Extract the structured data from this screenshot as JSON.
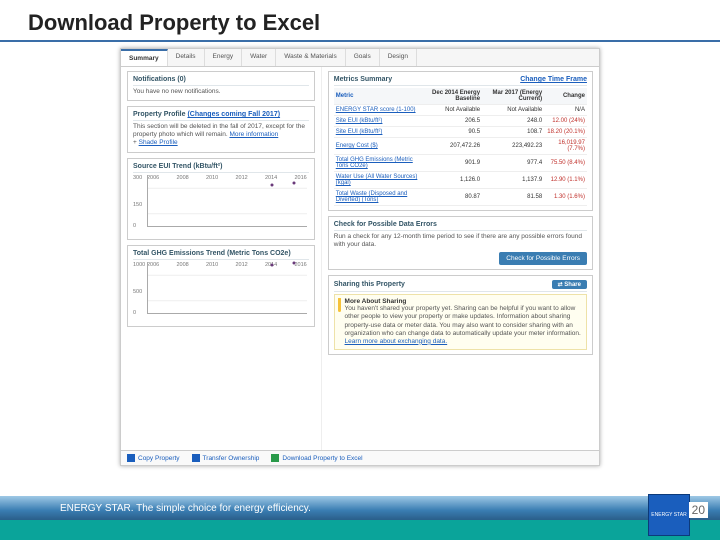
{
  "slide": {
    "title": "Download Property to Excel",
    "page_number": "20"
  },
  "footer": {
    "tagline": "ENERGY STAR. The simple choice for energy efficiency.",
    "logo": "ENERGY STAR"
  },
  "tabs": [
    "Summary",
    "Details",
    "Energy",
    "Water",
    "Waste & Materials",
    "Goals",
    "Design"
  ],
  "notifications": {
    "title": "Notifications (0)",
    "body": "You have no new notifications."
  },
  "profile": {
    "title": "Property Profile",
    "changes_link": "(Changes coming Fall 2017)",
    "body": "This section will be deleted in the fall of 2017, except for the property photo which will remain.",
    "more": "More information",
    "shade": "Shade Profile"
  },
  "source_chart": {
    "title": "Source EUI Trend (kBtu/ft²)"
  },
  "ghg_chart": {
    "title": "Total GHG Emissions Trend (Metric Tons CO2e)"
  },
  "metrics_summary": {
    "title": "Metrics Summary",
    "change_link": "Change Time Frame"
  },
  "metrics_headers": {
    "metric": "Metric",
    "baseline": "Dec 2014 Energy Baseline",
    "current": "Mar 2017 (Energy Current)",
    "change": "Change"
  },
  "metrics_rows": [
    {
      "label": "ENERGY STAR score (1-100)",
      "b": "Not Available",
      "c": "Not Available",
      "d": "N/A",
      "cls": ""
    },
    {
      "label": "Site EUI (kBtu/ft²)",
      "b": "206.5",
      "c": "248.0",
      "d": "12.00 (24%)",
      "cls": "chg-dn"
    },
    {
      "label": "Site EUI (kBtu/ft²)",
      "b": "90.5",
      "c": "108.7",
      "d": "18.20 (20.1%)",
      "cls": "chg-dn"
    },
    {
      "label": "Energy Cost ($)",
      "b": "207,472.26",
      "c": "223,492.23",
      "d": "16,019.97 (7.7%)",
      "cls": "chg-dn"
    },
    {
      "label": "Total GHG Emissions (Metric Tons CO2e)",
      "b": "901.9",
      "c": "977.4",
      "d": "75.50 (8.4%)",
      "cls": "chg-dn"
    },
    {
      "label": "Water Use (All Water Sources) (kgal)",
      "b": "1,126.0",
      "c": "1,137.9",
      "d": "12.90 (1.1%)",
      "cls": "chg-dn"
    },
    {
      "label": "Total Waste (Disposed and Diverted) (Tons)",
      "b": "80.87",
      "c": "81.58",
      "d": "1.30 (1.6%)",
      "cls": "chg-dn"
    }
  ],
  "errors": {
    "title": "Check for Possible Data Errors",
    "body": "Run a check for any 12-month time period to see if there are any possible errors found with your data.",
    "button": "Check for Possible Errors"
  },
  "sharing": {
    "title": "Sharing this Property",
    "share_btn": "Share",
    "more_title": "More About Sharing",
    "more_body": "You haven't shared your property yet. Sharing can be helpful if you want to allow other people to view your property or make updates. Information about sharing property-use data or meter data. You may also want to consider sharing with an organization who can change data to automatically update your meter information.",
    "learn_link": "Learn more about exchanging data."
  },
  "footer_links": {
    "copy": "Copy Property",
    "transfer": "Transfer Ownership",
    "download": "Download Property to Excel"
  },
  "chart_data": [
    {
      "type": "line",
      "title": "Source EUI Trend (kBtu/ft²)",
      "x": [
        2006,
        2008,
        2010,
        2012,
        2014,
        2016
      ],
      "ylim": [
        0,
        300
      ],
      "series": [
        {
          "name": "Source EUI",
          "values": [
            null,
            null,
            null,
            null,
            225,
            240
          ]
        }
      ]
    },
    {
      "type": "line",
      "title": "Total GHG Emissions Trend (Metric Tons CO2e)",
      "x": [
        2006,
        2008,
        2010,
        2012,
        2014,
        2016
      ],
      "ylim": [
        0,
        1000
      ],
      "series": [
        {
          "name": "GHG",
          "values": [
            null,
            null,
            null,
            null,
            900,
            950
          ]
        }
      ]
    }
  ]
}
